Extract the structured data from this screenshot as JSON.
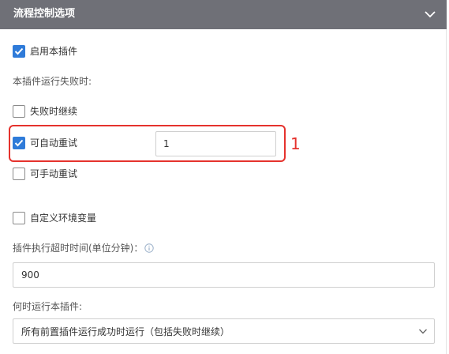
{
  "panel": {
    "title": "流程控制选项"
  },
  "options": {
    "enable_plugin_label": "启用本插件",
    "enable_plugin_checked": true,
    "on_failure_heading": "本插件运行失败时:",
    "continue_on_fail_label": "失败时继续",
    "continue_on_fail_checked": false,
    "auto_retry_label": "可自动重试",
    "auto_retry_checked": true,
    "auto_retry_count": "1",
    "manual_retry_label": "可手动重试",
    "manual_retry_checked": false,
    "custom_env_label": "自定义环境变量",
    "custom_env_checked": false
  },
  "timeout": {
    "label": "插件执行超时时间(单位分钟)：",
    "value": "900"
  },
  "run_condition": {
    "label": "何时运行本插件:",
    "selected": "所有前置插件运行成功时运行（包括失败时继续）"
  },
  "annotation": {
    "number": "1"
  },
  "colors": {
    "header_bg": "#6f7077",
    "accent": "#2f7bd9",
    "highlight": "#e5322d"
  },
  "icons": {
    "collapse": "chevron-down-icon",
    "info": "info-icon",
    "select": "chevron-down-icon",
    "check": "checkmark-icon"
  }
}
